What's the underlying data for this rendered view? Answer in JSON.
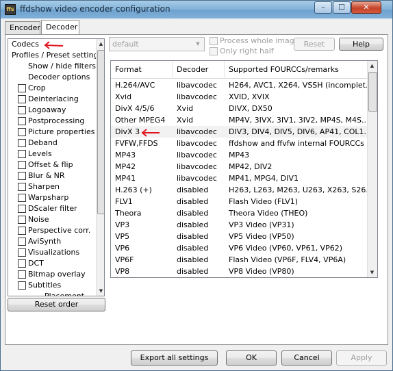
{
  "window": {
    "title": "ffdshow video encoder configuration",
    "icon_text": "ffs",
    "minimize": "–",
    "maximize": "☐",
    "close": "✕"
  },
  "tabs": [
    {
      "label": "Encoder"
    },
    {
      "label": "Decoder"
    }
  ],
  "tree": {
    "items": [
      {
        "label": "Codecs"
      },
      {
        "label": "Profiles / Preset settings"
      },
      {
        "label": "Show / hide filters"
      },
      {
        "label": "Decoder options"
      }
    ],
    "filters": [
      {
        "label": "Crop"
      },
      {
        "label": "Deinterlacing"
      },
      {
        "label": "Logoaway"
      },
      {
        "label": "Postprocessing"
      },
      {
        "label": "Picture properties"
      },
      {
        "label": "Deband"
      },
      {
        "label": "Levels"
      },
      {
        "label": "Offset & flip"
      },
      {
        "label": "Blur & NR"
      },
      {
        "label": "Sharpen"
      },
      {
        "label": "Warpsharp"
      },
      {
        "label": "DScaler filter"
      },
      {
        "label": "Noise"
      },
      {
        "label": "Perspective corr."
      },
      {
        "label": "AviSynth"
      },
      {
        "label": "Visualizations"
      },
      {
        "label": "DCT"
      },
      {
        "label": "Bitmap overlay"
      },
      {
        "label": "Subtitles"
      }
    ],
    "partial_item": "Placement"
  },
  "reset_order": "Reset order",
  "preset": {
    "value": "default"
  },
  "options": {
    "process_whole_image": "Process whole image",
    "only_right_half": "Only right half"
  },
  "reset_button": "Reset",
  "help_button": "Help",
  "codecs_table": {
    "headers": {
      "format": "Format",
      "decoder": "Decoder",
      "fourcc": "Supported FOURCCs/remarks"
    },
    "rows": [
      {
        "format": "H.264/AVC",
        "decoder": "libavcodec",
        "fourcc": "H264, AVC1, X264, VSSH (incomplet..."
      },
      {
        "format": "Xvid",
        "decoder": "libavcodec",
        "fourcc": "XVID, XVIX"
      },
      {
        "format": "DivX 4/5/6",
        "decoder": "Xvid",
        "fourcc": "DIVX, DX50"
      },
      {
        "format": "Other MPEG4",
        "decoder": "Xvid",
        "fourcc": "MP4V, 3IVX, 3IV1, 3IV2, MP4S, M4S..."
      },
      {
        "format": "DivX 3",
        "decoder": "libavcodec",
        "fourcc": "DIV3, DIV4, DIV5, DIV6, AP41, COL1..."
      },
      {
        "format": "FVFW,FFDS",
        "decoder": "libavcodec",
        "fourcc": "ffdshow and ffvfw internal FOURCCs"
      },
      {
        "format": "MP43",
        "decoder": "libavcodec",
        "fourcc": "MP43"
      },
      {
        "format": "MP42",
        "decoder": "libavcodec",
        "fourcc": "MP42, DIV2"
      },
      {
        "format": "MP41",
        "decoder": "libavcodec",
        "fourcc": "MP41, MPG4, DIV1"
      },
      {
        "format": "H.263 (+)",
        "decoder": "disabled",
        "fourcc": "H263, L263, M263, U263, X263, S26..."
      },
      {
        "format": "FLV1",
        "decoder": "disabled",
        "fourcc": "Flash Video (FLV1)"
      },
      {
        "format": "Theora",
        "decoder": "disabled",
        "fourcc": "Theora Video (THEO)"
      },
      {
        "format": "VP3",
        "decoder": "disabled",
        "fourcc": "VP3 Video (VP31)"
      },
      {
        "format": "VP5",
        "decoder": "disabled",
        "fourcc": "VP5 Video (VP50)"
      },
      {
        "format": "VP6",
        "decoder": "disabled",
        "fourcc": "VP6 Video (VP60, VP61, VP62)"
      },
      {
        "format": "VP6F",
        "decoder": "disabled",
        "fourcc": "Flash Video (VP6F, FLV4, VP6A)"
      },
      {
        "format": "VP8",
        "decoder": "disabled",
        "fourcc": "VP8 Video (VP80)"
      }
    ],
    "selected_row": 4
  },
  "bottom": {
    "export": "Export all settings",
    "ok": "OK",
    "cancel": "Cancel",
    "apply": "Apply"
  },
  "colors": {
    "annotation": "#e0141e",
    "title_bar": "#85b4da",
    "selected_row": "#f2f2f2"
  }
}
